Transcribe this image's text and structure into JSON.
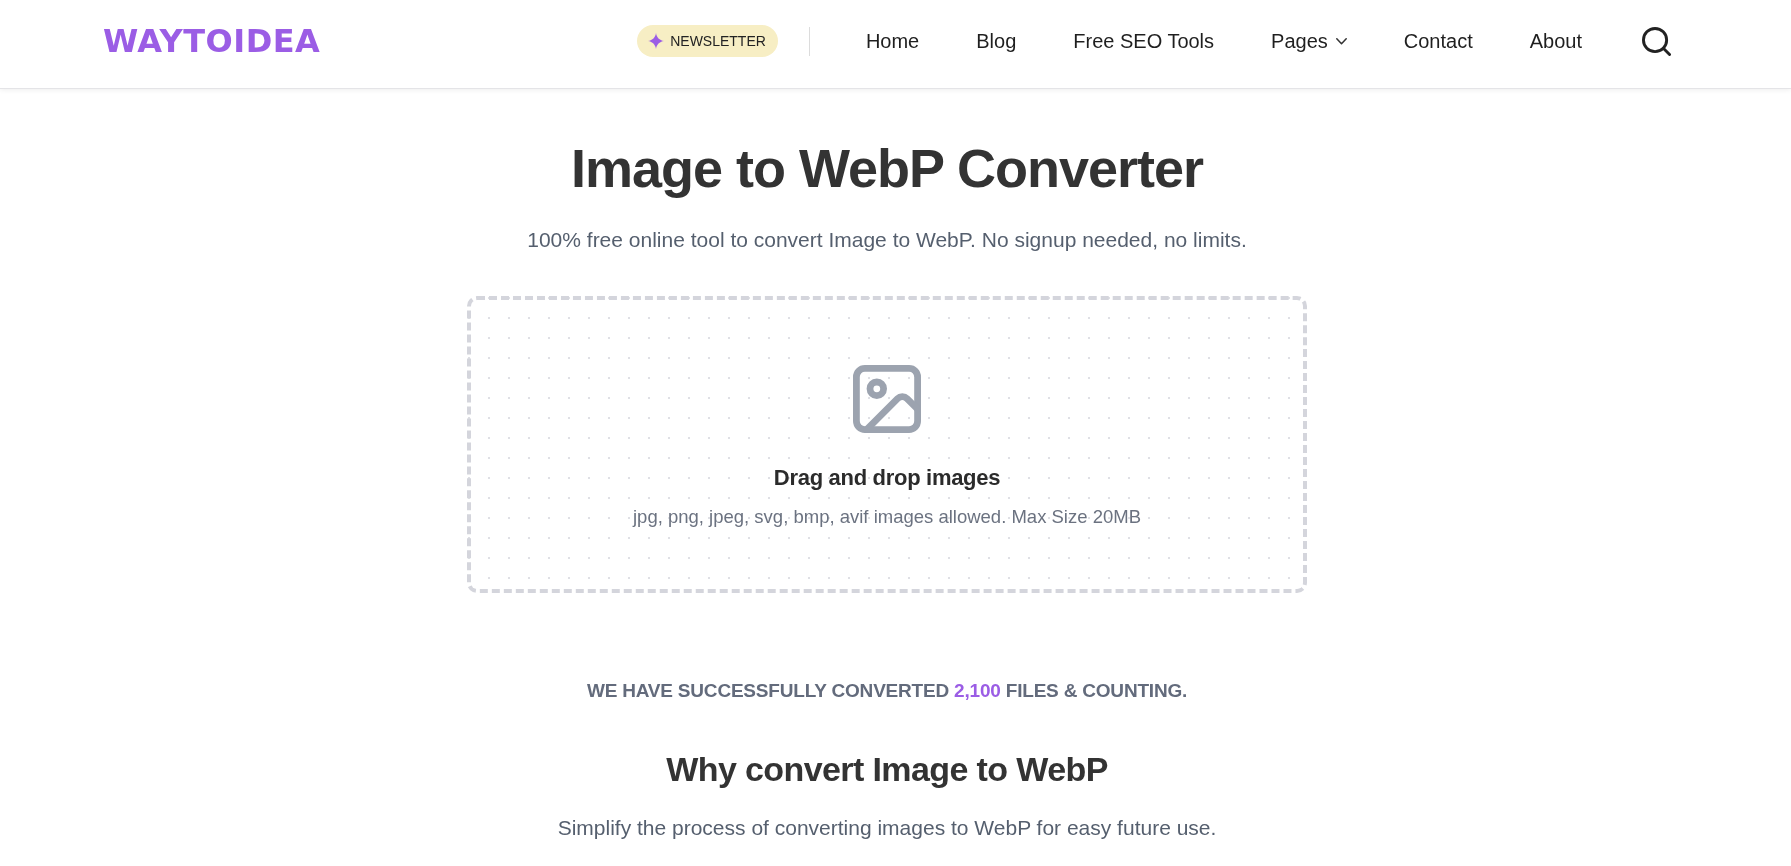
{
  "header": {
    "logo": "WAYTOIDEA",
    "newsletter": "NEWSLETTER",
    "nav": [
      {
        "label": "Home",
        "kind": "link"
      },
      {
        "label": "Blog",
        "kind": "link"
      },
      {
        "label": "Free SEO Tools",
        "kind": "link"
      },
      {
        "label": "Pages",
        "kind": "dropdown"
      },
      {
        "label": "Contact",
        "kind": "link"
      },
      {
        "label": "About",
        "kind": "link"
      }
    ]
  },
  "hero": {
    "title": "Image to WebP Converter",
    "subtitle": "100% free online tool to convert Image to WebP. No signup needed, no limits."
  },
  "dropzone": {
    "heading": "Drag and drop images",
    "hint": "jpg, png, jpeg, svg, bmp, avif images allowed. Max Size 20MB"
  },
  "stats": {
    "before": "WE HAVE SUCCESSFULLY CONVERTED",
    "count": "2,100",
    "after": "FILES & COUNTING."
  },
  "why": {
    "title": "Why convert Image to WebP",
    "text": "Simplify the process of converting images to WebP for easy future use."
  }
}
